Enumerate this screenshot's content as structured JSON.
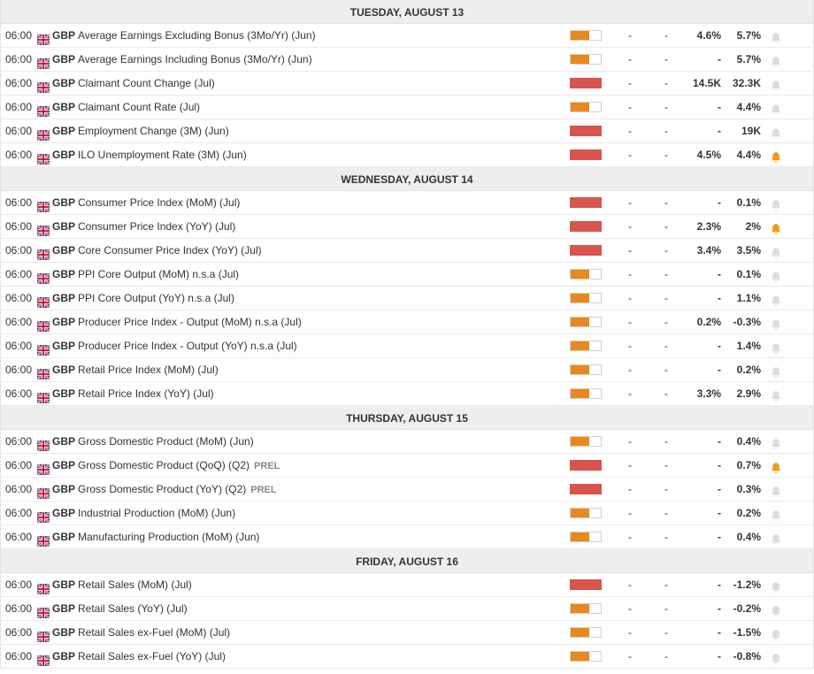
{
  "colors": {
    "high": "#d9534f",
    "medium": "#e8891d",
    "bell_active": "#f09a1a",
    "bell_inactive": "#dcdcdc"
  },
  "icons": {
    "flag": "uk-flag-icon",
    "alert": "bell-icon"
  },
  "days": [
    {
      "label": "TUESDAY, AUGUST 13",
      "events": [
        {
          "time": "06:00",
          "currency": "GBP",
          "name": "Average Earnings Excluding Bonus (3Mo/Yr) (Jun)",
          "prel": "",
          "impact": "medium",
          "actual": "-",
          "deviation": "-",
          "consensus": "4.6%",
          "previous": "5.7%",
          "bell": false
        },
        {
          "time": "06:00",
          "currency": "GBP",
          "name": "Average Earnings Including Bonus (3Mo/Yr) (Jun)",
          "prel": "",
          "impact": "medium",
          "actual": "-",
          "deviation": "-",
          "consensus": "-",
          "previous": "5.7%",
          "bell": false
        },
        {
          "time": "06:00",
          "currency": "GBP",
          "name": "Claimant Count Change (Jul)",
          "prel": "",
          "impact": "high",
          "actual": "-",
          "deviation": "-",
          "consensus": "14.5K",
          "previous": "32.3K",
          "bell": false
        },
        {
          "time": "06:00",
          "currency": "GBP",
          "name": "Claimant Count Rate (Jul)",
          "prel": "",
          "impact": "medium",
          "actual": "-",
          "deviation": "-",
          "consensus": "-",
          "previous": "4.4%",
          "bell": false
        },
        {
          "time": "06:00",
          "currency": "GBP",
          "name": "Employment Change (3M) (Jun)",
          "prel": "",
          "impact": "high",
          "actual": "-",
          "deviation": "-",
          "consensus": "-",
          "previous": "19K",
          "bell": false
        },
        {
          "time": "06:00",
          "currency": "GBP",
          "name": "ILO Unemployment Rate (3M) (Jun)",
          "prel": "",
          "impact": "high",
          "actual": "-",
          "deviation": "-",
          "consensus": "4.5%",
          "previous": "4.4%",
          "bell": true
        }
      ]
    },
    {
      "label": "WEDNESDAY, AUGUST 14",
      "events": [
        {
          "time": "06:00",
          "currency": "GBP",
          "name": "Consumer Price Index (MoM) (Jul)",
          "prel": "",
          "impact": "high",
          "actual": "-",
          "deviation": "-",
          "consensus": "-",
          "previous": "0.1%",
          "bell": false
        },
        {
          "time": "06:00",
          "currency": "GBP",
          "name": "Consumer Price Index (YoY) (Jul)",
          "prel": "",
          "impact": "high",
          "actual": "-",
          "deviation": "-",
          "consensus": "2.3%",
          "previous": "2%",
          "bell": true
        },
        {
          "time": "06:00",
          "currency": "GBP",
          "name": "Core Consumer Price Index (YoY) (Jul)",
          "prel": "",
          "impact": "high",
          "actual": "-",
          "deviation": "-",
          "consensus": "3.4%",
          "previous": "3.5%",
          "bell": false
        },
        {
          "time": "06:00",
          "currency": "GBP",
          "name": "PPI Core Output (MoM) n.s.a (Jul)",
          "prel": "",
          "impact": "medium",
          "actual": "-",
          "deviation": "-",
          "consensus": "-",
          "previous": "0.1%",
          "bell": false
        },
        {
          "time": "06:00",
          "currency": "GBP",
          "name": "PPI Core Output (YoY) n.s.a (Jul)",
          "prel": "",
          "impact": "medium",
          "actual": "-",
          "deviation": "-",
          "consensus": "-",
          "previous": "1.1%",
          "bell": false
        },
        {
          "time": "06:00",
          "currency": "GBP",
          "name": "Producer Price Index - Output (MoM) n.s.a (Jul)",
          "prel": "",
          "impact": "medium",
          "actual": "-",
          "deviation": "-",
          "consensus": "0.2%",
          "previous": "-0.3%",
          "bell": false
        },
        {
          "time": "06:00",
          "currency": "GBP",
          "name": "Producer Price Index - Output (YoY) n.s.a (Jul)",
          "prel": "",
          "impact": "medium",
          "actual": "-",
          "deviation": "-",
          "consensus": "-",
          "previous": "1.4%",
          "bell": false
        },
        {
          "time": "06:00",
          "currency": "GBP",
          "name": "Retail Price Index (MoM) (Jul)",
          "prel": "",
          "impact": "medium",
          "actual": "-",
          "deviation": "-",
          "consensus": "-",
          "previous": "0.2%",
          "bell": false
        },
        {
          "time": "06:00",
          "currency": "GBP",
          "name": "Retail Price Index (YoY) (Jul)",
          "prel": "",
          "impact": "medium",
          "actual": "-",
          "deviation": "-",
          "consensus": "3.3%",
          "previous": "2.9%",
          "bell": false
        }
      ]
    },
    {
      "label": "THURSDAY, AUGUST 15",
      "events": [
        {
          "time": "06:00",
          "currency": "GBP",
          "name": "Gross Domestic Product (MoM) (Jun)",
          "prel": "",
          "impact": "medium",
          "actual": "-",
          "deviation": "-",
          "consensus": "-",
          "previous": "0.4%",
          "bell": false
        },
        {
          "time": "06:00",
          "currency": "GBP",
          "name": "Gross Domestic Product (QoQ) (Q2)",
          "prel": "PREL",
          "impact": "high",
          "actual": "-",
          "deviation": "-",
          "consensus": "-",
          "previous": "0.7%",
          "bell": true
        },
        {
          "time": "06:00",
          "currency": "GBP",
          "name": "Gross Domestic Product (YoY) (Q2)",
          "prel": "PREL",
          "impact": "high",
          "actual": "-",
          "deviation": "-",
          "consensus": "-",
          "previous": "0.3%",
          "bell": false
        },
        {
          "time": "06:00",
          "currency": "GBP",
          "name": "Industrial Production (MoM) (Jun)",
          "prel": "",
          "impact": "medium",
          "actual": "-",
          "deviation": "-",
          "consensus": "-",
          "previous": "0.2%",
          "bell": false
        },
        {
          "time": "06:00",
          "currency": "GBP",
          "name": "Manufacturing Production (MoM) (Jun)",
          "prel": "",
          "impact": "medium",
          "actual": "-",
          "deviation": "-",
          "consensus": "-",
          "previous": "0.4%",
          "bell": false
        }
      ]
    },
    {
      "label": "FRIDAY, AUGUST 16",
      "events": [
        {
          "time": "06:00",
          "currency": "GBP",
          "name": "Retail Sales (MoM) (Jul)",
          "prel": "",
          "impact": "high",
          "actual": "-",
          "deviation": "-",
          "consensus": "-",
          "previous": "-1.2%",
          "bell": false
        },
        {
          "time": "06:00",
          "currency": "GBP",
          "name": "Retail Sales (YoY) (Jul)",
          "prel": "",
          "impact": "medium",
          "actual": "-",
          "deviation": "-",
          "consensus": "-",
          "previous": "-0.2%",
          "bell": false
        },
        {
          "time": "06:00",
          "currency": "GBP",
          "name": "Retail Sales ex-Fuel (MoM) (Jul)",
          "prel": "",
          "impact": "medium",
          "actual": "-",
          "deviation": "-",
          "consensus": "-",
          "previous": "-1.5%",
          "bell": false
        },
        {
          "time": "06:00",
          "currency": "GBP",
          "name": "Retail Sales ex-Fuel (YoY) (Jul)",
          "prel": "",
          "impact": "medium",
          "actual": "-",
          "deviation": "-",
          "consensus": "-",
          "previous": "-0.8%",
          "bell": false
        }
      ]
    }
  ]
}
